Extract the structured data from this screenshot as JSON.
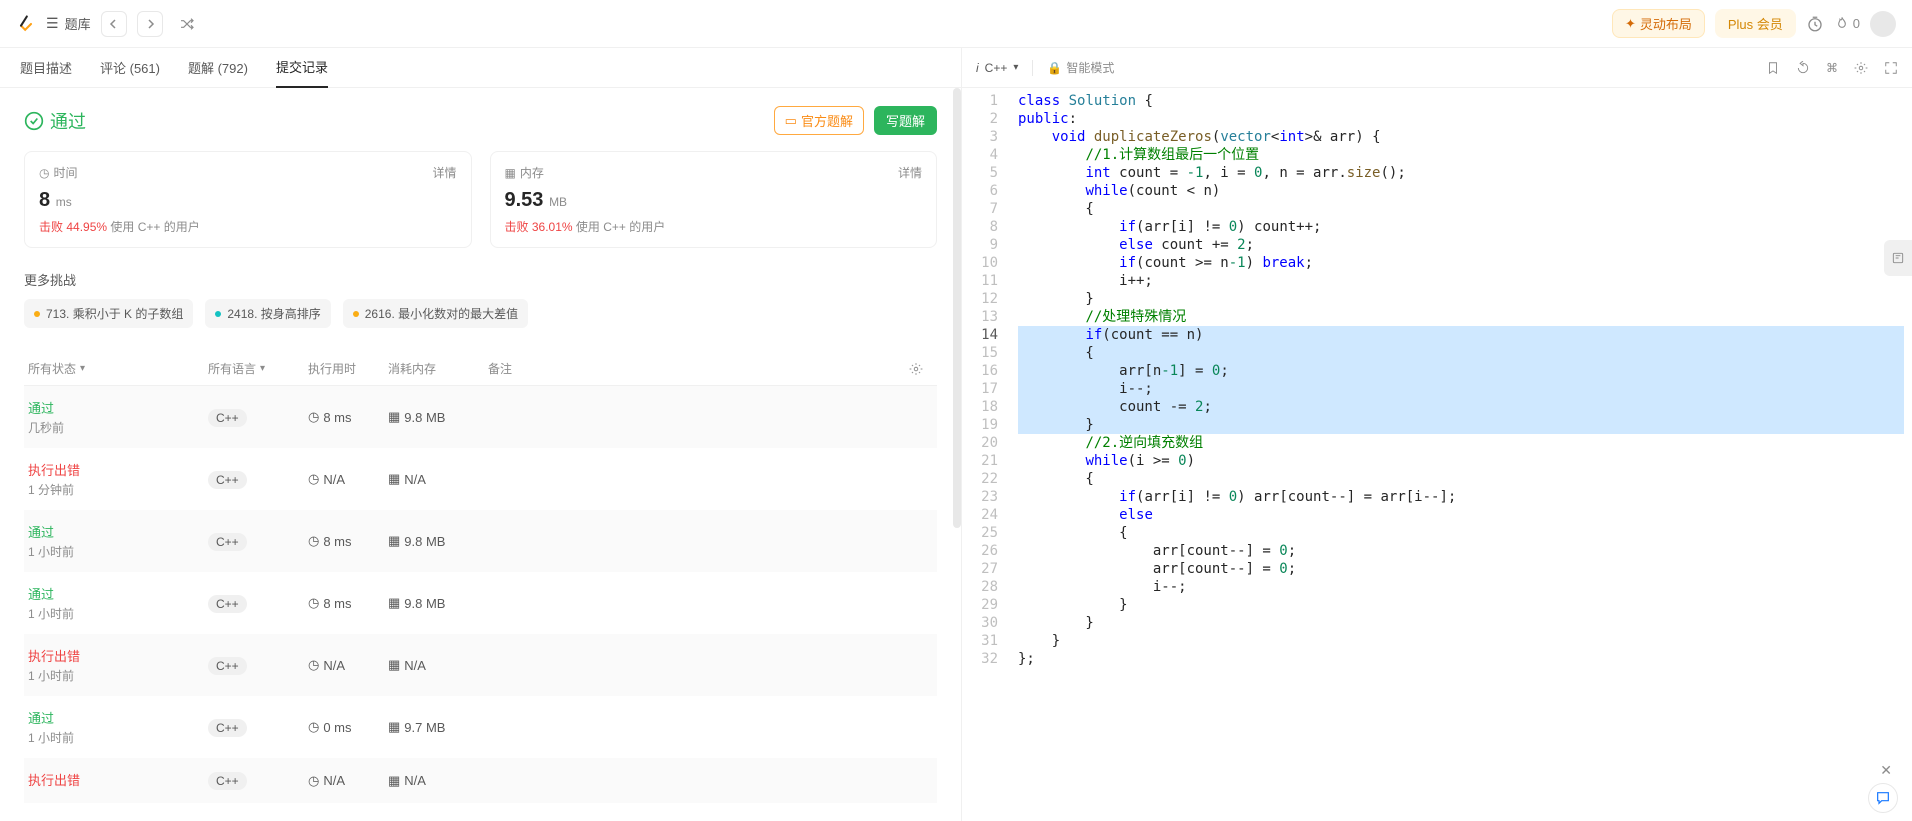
{
  "topbar": {
    "crumb": "题库",
    "layout_btn": "灵动布局",
    "plus_btn": "Plus 会员",
    "flame_count": "0"
  },
  "tabs": [
    {
      "label": "题目描述"
    },
    {
      "label": "评论 (561)"
    },
    {
      "label": "题解 (792)"
    },
    {
      "label": "提交记录"
    }
  ],
  "status": {
    "text": "通过",
    "official": "官方题解",
    "write": "写题解"
  },
  "cards": {
    "time": {
      "title": "时间",
      "detail": "详情",
      "value": "8",
      "unit": "ms",
      "beat_lbl": "击败",
      "pct": "44.95%",
      "suffix": " 使用 C++ 的用户"
    },
    "mem": {
      "title": "内存",
      "detail": "详情",
      "value": "9.53",
      "unit": "MB",
      "beat_lbl": "击败",
      "pct": "36.01%",
      "suffix": " 使用 C++ 的用户"
    }
  },
  "more_label": "更多挑战",
  "challenges": [
    {
      "color": "y",
      "text": "713. 乘积小于 K 的子数组"
    },
    {
      "color": "t",
      "text": "2418. 按身高排序"
    },
    {
      "color": "y",
      "text": "2616. 最小化数对的最大差值"
    }
  ],
  "table": {
    "headers": {
      "status": "所有状态",
      "lang": "所有语言",
      "rt": "执行用时",
      "mem": "消耗内存",
      "note": "备注"
    },
    "rows": [
      {
        "status": "通过",
        "st": "pass",
        "ago": "几秒前",
        "lang": "C++",
        "rt": "8 ms",
        "mem": "9.8 MB"
      },
      {
        "status": "执行出错",
        "st": "err",
        "ago": "1 分钟前",
        "lang": "C++",
        "rt": "N/A",
        "mem": "N/A"
      },
      {
        "status": "通过",
        "st": "pass",
        "ago": "1 小时前",
        "lang": "C++",
        "rt": "8 ms",
        "mem": "9.8 MB"
      },
      {
        "status": "通过",
        "st": "pass",
        "ago": "1 小时前",
        "lang": "C++",
        "rt": "8 ms",
        "mem": "9.8 MB"
      },
      {
        "status": "执行出错",
        "st": "err",
        "ago": "1 小时前",
        "lang": "C++",
        "rt": "N/A",
        "mem": "N/A"
      },
      {
        "status": "通过",
        "st": "pass",
        "ago": "1 小时前",
        "lang": "C++",
        "rt": "0 ms",
        "mem": "9.7 MB"
      },
      {
        "status": "执行出错",
        "st": "err",
        "ago": "",
        "lang": "C++",
        "rt": "N/A",
        "mem": "N/A"
      }
    ]
  },
  "editor": {
    "lang": "C++",
    "smart": "智能模式",
    "breakpoint_line": 10,
    "current_line": 14,
    "selected_lines": [
      14,
      15,
      16,
      17,
      18,
      19
    ]
  },
  "code": [
    {
      "t": [
        [
          "kw",
          "class"
        ],
        [
          "",
          " "
        ],
        [
          "typ",
          "Solution"
        ],
        [
          "",
          " {"
        ]
      ]
    },
    {
      "t": [
        [
          "kw",
          "public"
        ],
        [
          "",
          ":"
        ]
      ]
    },
    {
      "t": [
        [
          "",
          "    "
        ],
        [
          "kw",
          "void"
        ],
        [
          "",
          " "
        ],
        [
          "fn",
          "duplicateZeros"
        ],
        [
          "",
          "("
        ],
        [
          "typ",
          "vector"
        ],
        [
          "",
          "<"
        ],
        [
          "kw",
          "int"
        ],
        [
          "",
          ">& arr) {"
        ]
      ]
    },
    {
      "t": [
        [
          "",
          "        "
        ],
        [
          "cm",
          "//1.计算数组最后一个位置"
        ]
      ]
    },
    {
      "t": [
        [
          "",
          "        "
        ],
        [
          "kw",
          "int"
        ],
        [
          "",
          " count = "
        ],
        [
          "num",
          "-1"
        ],
        [
          "",
          ", i = "
        ],
        [
          "num",
          "0"
        ],
        [
          "",
          ", n = arr."
        ],
        [
          "fn",
          "size"
        ],
        [
          "",
          "();"
        ]
      ]
    },
    {
      "t": [
        [
          "",
          "        "
        ],
        [
          "kw",
          "while"
        ],
        [
          "",
          "(count < n)"
        ]
      ]
    },
    {
      "t": [
        [
          "",
          "        {"
        ]
      ]
    },
    {
      "t": [
        [
          "",
          "            "
        ],
        [
          "kw",
          "if"
        ],
        [
          "",
          "(arr[i] != "
        ],
        [
          "num",
          "0"
        ],
        [
          "",
          ") count++;"
        ]
      ]
    },
    {
      "t": [
        [
          "",
          "            "
        ],
        [
          "kw",
          "else"
        ],
        [
          "",
          " count += "
        ],
        [
          "num",
          "2"
        ],
        [
          "",
          ";"
        ]
      ]
    },
    {
      "t": [
        [
          "",
          "            "
        ],
        [
          "kw",
          "if"
        ],
        [
          "",
          "(count >= n"
        ],
        [
          "num",
          "-1"
        ],
        [
          "",
          ") "
        ],
        [
          "kw",
          "break"
        ],
        [
          "",
          ";"
        ]
      ]
    },
    {
      "t": [
        [
          "",
          "            i++;"
        ]
      ]
    },
    {
      "t": [
        [
          "",
          "        }"
        ]
      ]
    },
    {
      "t": [
        [
          "",
          "        "
        ],
        [
          "cm",
          "//处理特殊情况"
        ]
      ]
    },
    {
      "t": [
        [
          "",
          "        "
        ],
        [
          "kw",
          "if"
        ],
        [
          "",
          "(count == n)"
        ]
      ]
    },
    {
      "t": [
        [
          "",
          "        {"
        ]
      ]
    },
    {
      "t": [
        [
          "",
          "            arr[n"
        ],
        [
          "num",
          "-1"
        ],
        [
          "",
          ""
        ],
        [
          "",
          "] = "
        ],
        [
          "num",
          "0"
        ],
        [
          "",
          ";"
        ]
      ]
    },
    {
      "t": [
        [
          "",
          "            i--;"
        ]
      ]
    },
    {
      "t": [
        [
          "",
          "            count -= "
        ],
        [
          "num",
          "2"
        ],
        [
          "",
          ";"
        ]
      ]
    },
    {
      "t": [
        [
          "",
          "        }"
        ]
      ]
    },
    {
      "t": [
        [
          "",
          "        "
        ],
        [
          "cm",
          "//2.逆向填充数组"
        ]
      ]
    },
    {
      "t": [
        [
          "",
          "        "
        ],
        [
          "kw",
          "while"
        ],
        [
          "",
          "(i >= "
        ],
        [
          "num",
          "0"
        ],
        [
          "",
          ")"
        ]
      ]
    },
    {
      "t": [
        [
          "",
          "        {"
        ]
      ]
    },
    {
      "t": [
        [
          "",
          "            "
        ],
        [
          "kw",
          "if"
        ],
        [
          "",
          "(arr[i] != "
        ],
        [
          "num",
          "0"
        ],
        [
          "",
          ") arr[count--] = arr[i--];"
        ]
      ]
    },
    {
      "t": [
        [
          "",
          "            "
        ],
        [
          "kw",
          "else"
        ]
      ]
    },
    {
      "t": [
        [
          "",
          "            {"
        ]
      ]
    },
    {
      "t": [
        [
          "",
          "                arr[count--] = "
        ],
        [
          "num",
          "0"
        ],
        [
          "",
          ";"
        ]
      ]
    },
    {
      "t": [
        [
          "",
          "                arr[count--] = "
        ],
        [
          "num",
          "0"
        ],
        [
          "",
          ";"
        ]
      ]
    },
    {
      "t": [
        [
          "",
          "                i--;"
        ]
      ]
    },
    {
      "t": [
        [
          "",
          "            }"
        ]
      ]
    },
    {
      "t": [
        [
          "",
          "        }"
        ]
      ]
    },
    {
      "t": [
        [
          "",
          "    }"
        ]
      ]
    },
    {
      "t": [
        [
          "",
          "};"
        ]
      ]
    }
  ]
}
